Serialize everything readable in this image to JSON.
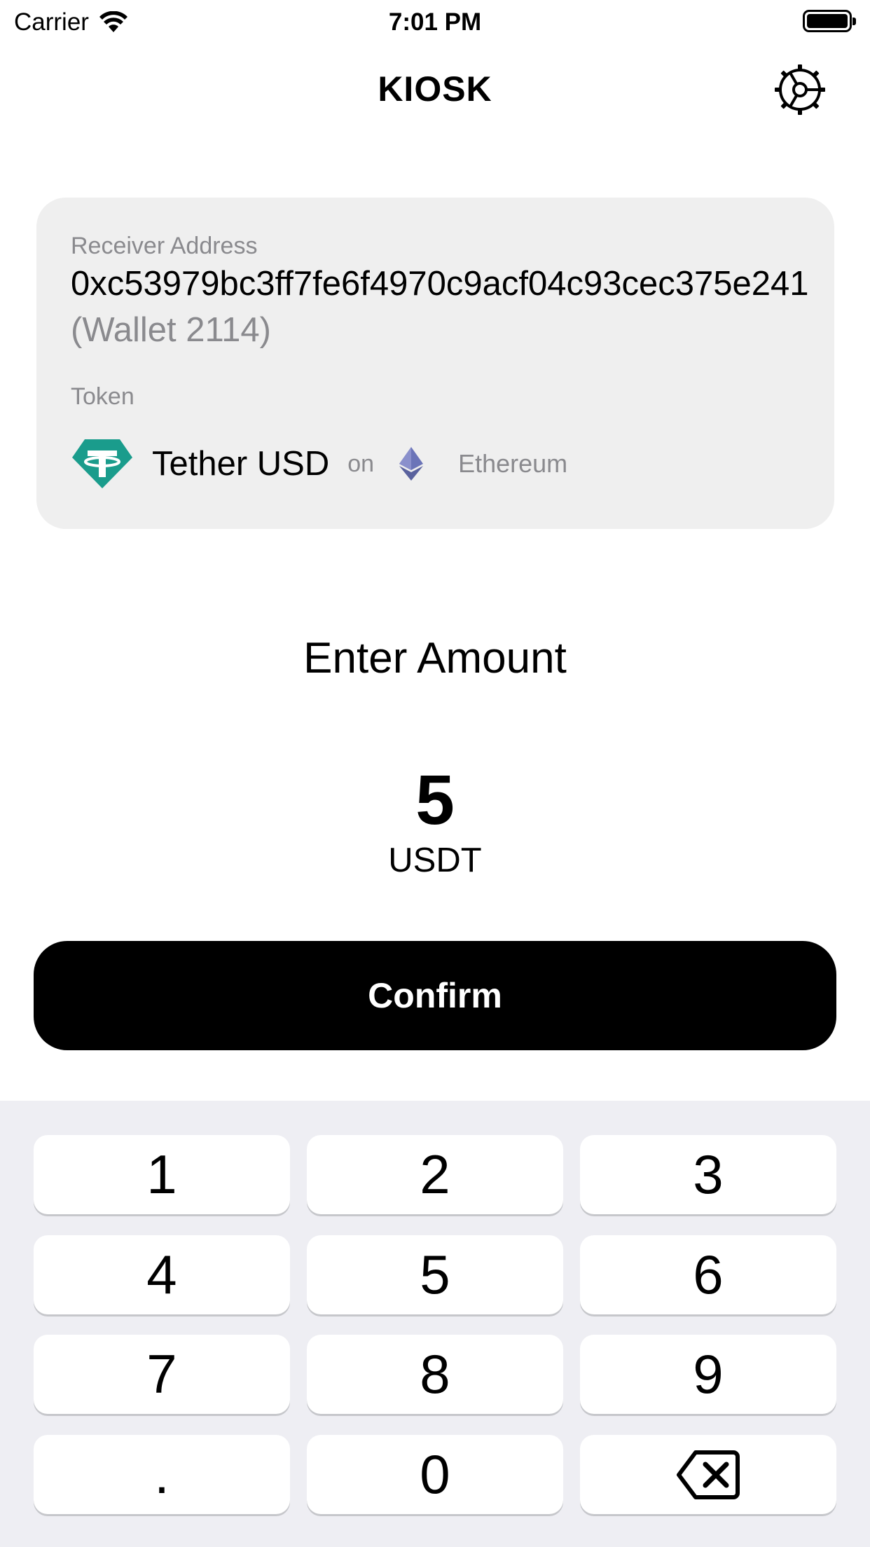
{
  "status_bar": {
    "carrier": "Carrier",
    "time": "7:01 PM"
  },
  "header": {
    "title": "KIOSK",
    "settings_icon": "gear-icon"
  },
  "card": {
    "receiver_label": "Receiver Address",
    "address": "0xc53979bc3ff7fe6f4970c9acf04c93cec375e241",
    "wallet_name": "(Wallet 2114)",
    "token_label": "Token",
    "token_name": "Tether USD",
    "on_text": "on",
    "chain_name": "Ethereum",
    "token_icon": "tether-icon",
    "chain_icon": "ethereum-icon",
    "colors": {
      "tether": "#1a9c8c",
      "ethereum": "#6b74b8"
    }
  },
  "amount": {
    "heading": "Enter Amount",
    "value": "5",
    "unit": "USDT"
  },
  "confirm": {
    "label": "Confirm"
  },
  "keypad": {
    "keys": [
      "1",
      "2",
      "3",
      "4",
      "5",
      "6",
      "7",
      "8",
      "9",
      ".",
      "0"
    ],
    "backspace_icon": "backspace-icon"
  }
}
